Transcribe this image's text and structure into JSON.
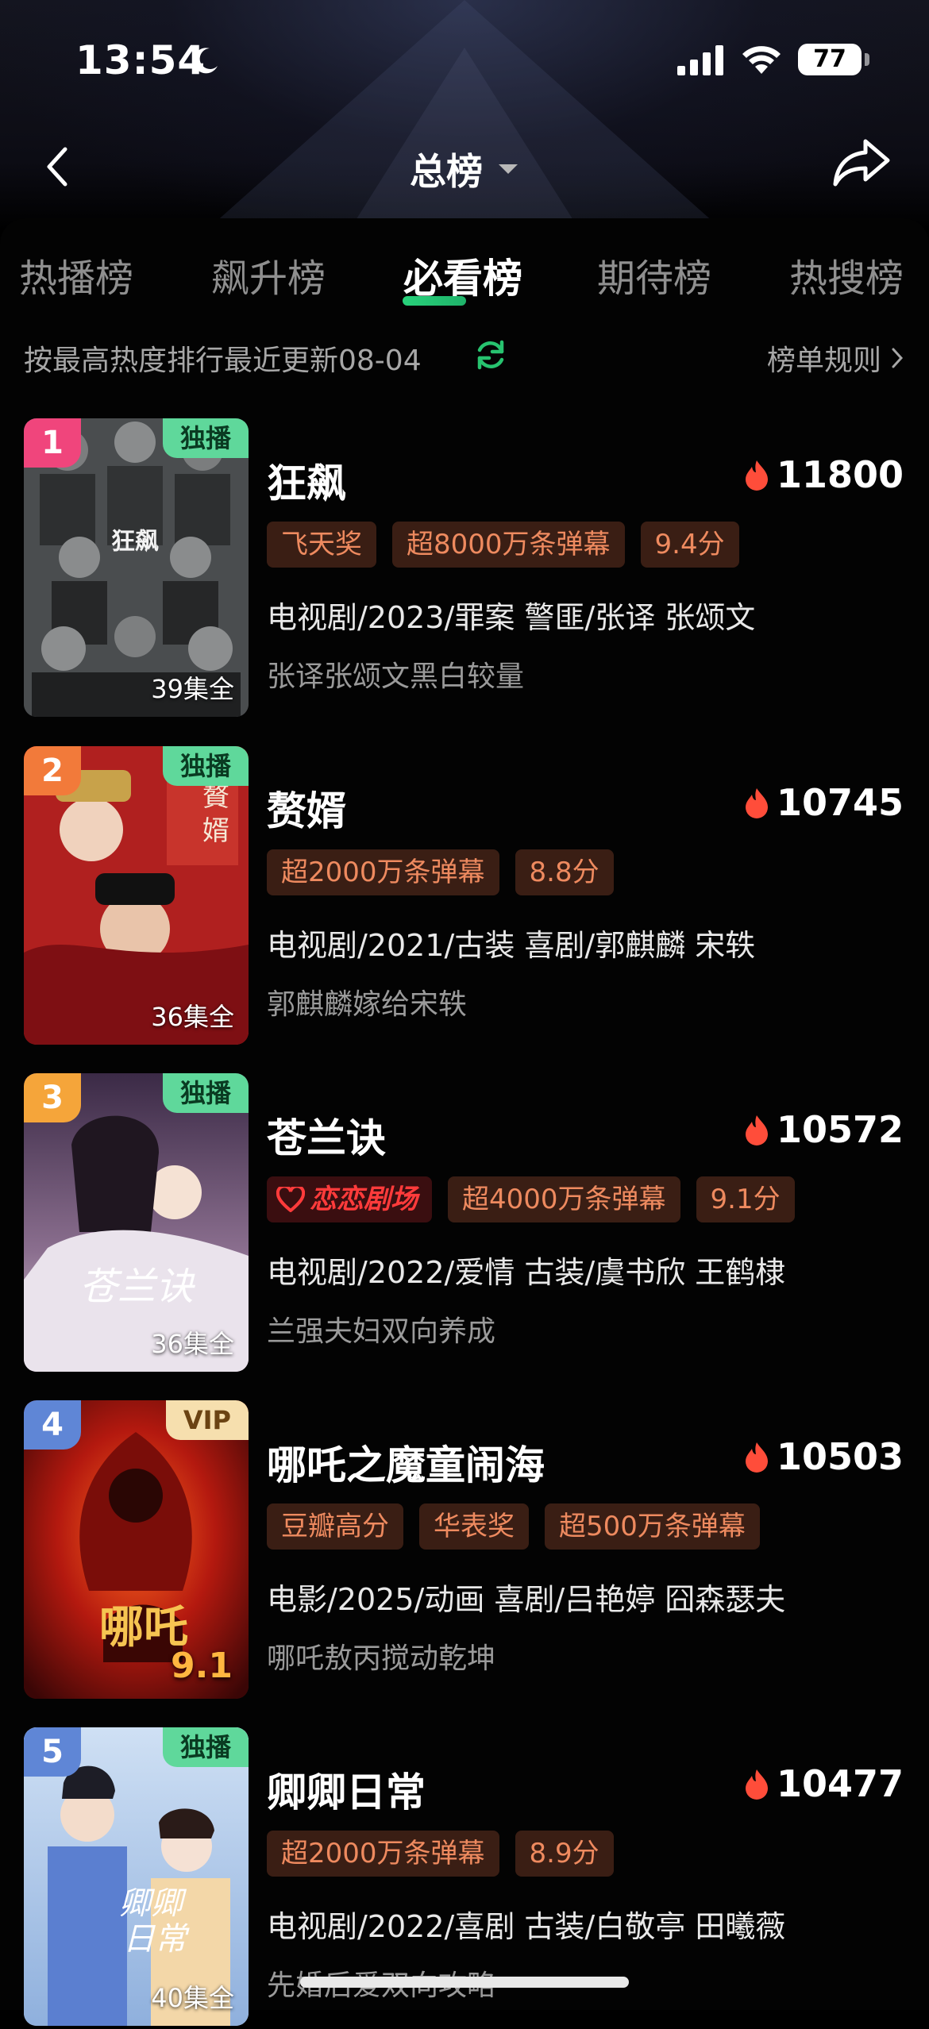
{
  "status_bar": {
    "time": "13:54",
    "battery": "77"
  },
  "nav": {
    "title": "总榜"
  },
  "tabs": [
    {
      "label": "热播榜",
      "active": false
    },
    {
      "label": "飙升榜",
      "active": false
    },
    {
      "label": "必看榜",
      "active": true
    },
    {
      "label": "期待榜",
      "active": false
    },
    {
      "label": "热搜榜",
      "active": false
    }
  ],
  "subline": {
    "text": "按最高热度排行最近更新08-04",
    "rules_label": "榜单规则"
  },
  "items": [
    {
      "rank": "1",
      "rank_color": "#f0457c",
      "corner_tag": "独播",
      "corner_type": "exclusive",
      "episodes": "39集全",
      "title": "狂飙",
      "heat": "11800",
      "badges": [
        "飞天奖",
        "超8000万条弹幕",
        "9.4分"
      ],
      "meta": "电视剧/2023/罪案 警匪/张译 张颂文",
      "desc": "张译张颂文黑白较量"
    },
    {
      "rank": "2",
      "rank_color": "#f27a3a",
      "corner_tag": "独播",
      "corner_type": "exclusive",
      "episodes": "36集全",
      "title": "赘婿",
      "heat": "10745",
      "badges": [
        "超2000万条弹幕",
        "8.8分"
      ],
      "meta": "电视剧/2021/古装 喜剧/郭麒麟 宋轶",
      "desc": "郭麒麟嫁给宋轶"
    },
    {
      "rank": "3",
      "rank_color": "#f5a53a",
      "corner_tag": "独播",
      "corner_type": "exclusive",
      "episodes": "36集全",
      "title": "苍兰诀",
      "heat": "10572",
      "brand_badge": "恋恋剧场",
      "badges": [
        "超4000万条弹幕",
        "9.1分"
      ],
      "meta": "电视剧/2022/爱情 古装/虞书欣 王鹤棣",
      "desc": "兰强夫妇双向养成"
    },
    {
      "rank": "4",
      "rank_color": "#5f86d6",
      "corner_tag": "VIP",
      "corner_type": "vip",
      "rating_overlay": "9.1",
      "title": "哪吒之魔童闹海",
      "heat": "10503",
      "badges": [
        "豆瓣高分",
        "华表奖",
        "超500万条弹幕"
      ],
      "meta": "电影/2025/动画 喜剧/吕艳婷 囧森瑟夫",
      "desc": "哪吒敖丙搅动乾坤"
    },
    {
      "rank": "5",
      "rank_color": "#5f86d6",
      "corner_tag": "独播",
      "corner_type": "exclusive",
      "episodes": "40集全",
      "title": "卿卿日常",
      "heat": "10477",
      "badges": [
        "超2000万条弹幕",
        "8.9分"
      ],
      "meta": "电视剧/2022/喜剧 古装/白敬亭 田曦薇",
      "desc": "先婚后爱双向攻略"
    }
  ]
}
